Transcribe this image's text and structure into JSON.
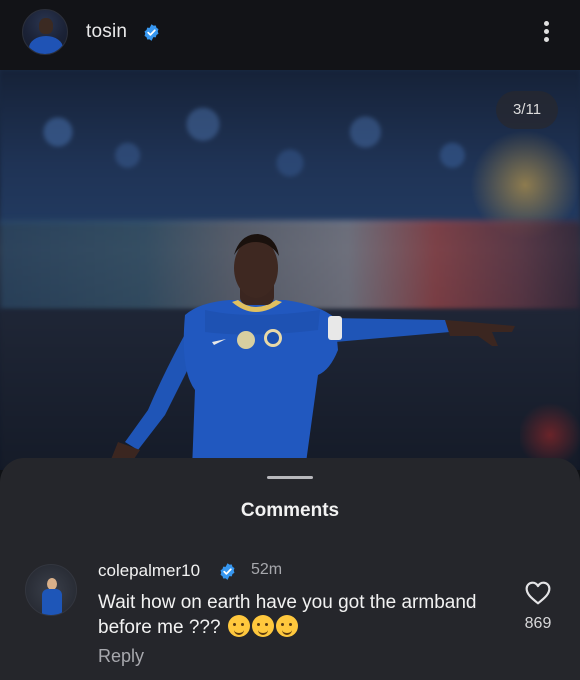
{
  "header": {
    "username": "tosin",
    "verified": true,
    "avatar_icon": "profile-avatar-icon",
    "more_icon": "more-options-icon"
  },
  "post": {
    "counter": "3/11"
  },
  "comments_sheet": {
    "title": "Comments",
    "comments": [
      {
        "username": "colepalmer10",
        "verified": true,
        "time": "52m",
        "text": "Wait how on earth have you got the armband before me ???",
        "emojis": [
          "hugging-face-emoji",
          "hugging-face-emoji",
          "hugging-face-emoji"
        ],
        "reply_label": "Reply",
        "likes": "869"
      }
    ]
  },
  "colors": {
    "header_bg": "#121317",
    "sheet_bg": "#25262b",
    "verified_blue": "#3797f0",
    "jersey_blue": "#1e56b8"
  }
}
